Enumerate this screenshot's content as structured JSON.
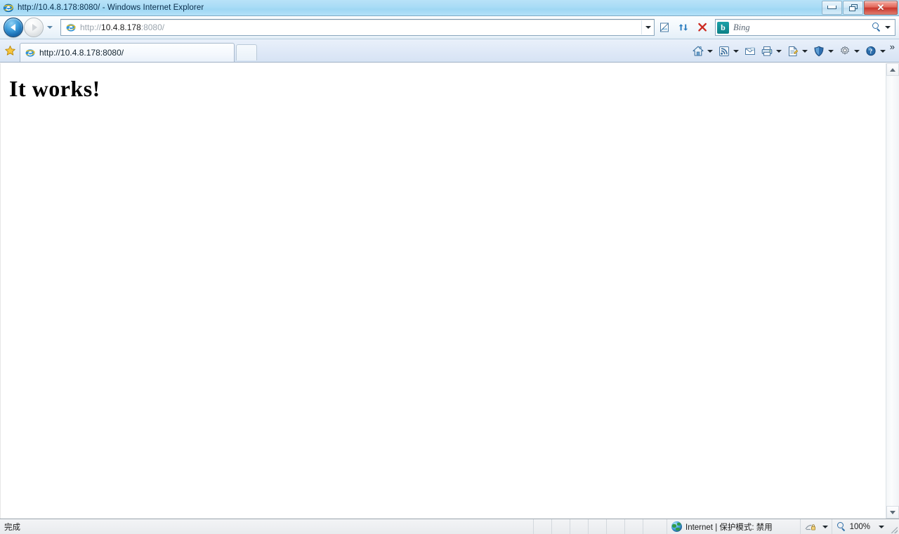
{
  "window": {
    "title": "http://10.4.8.178:8080/ - Windows Internet Explorer",
    "app_icon": "internet-explorer-icon",
    "controls": {
      "minimize_label": "–",
      "restore_label": "❐",
      "close_label": "✕"
    }
  },
  "navigation": {
    "back_label": "←",
    "forward_label": "→",
    "recent_pages_label": "▾"
  },
  "address_bar": {
    "favicon": "internet-explorer-icon",
    "url_scheme": "http://",
    "url_host": "10.4.8.178",
    "url_rest": ":8080/",
    "url_full": "http://10.4.8.178:8080/",
    "dropdown_label": "▾",
    "buttons": [
      {
        "name": "compatibility-view-button",
        "glyph": "▤"
      },
      {
        "name": "refresh-button",
        "glyph": "↻"
      },
      {
        "name": "stop-button",
        "glyph": "✕"
      }
    ]
  },
  "search": {
    "provider": "Bing",
    "placeholder": "Bing",
    "logo_letter": "b",
    "search_icon": "magnifier-icon",
    "dropdown_label": "▾"
  },
  "tabs": {
    "favorites_star": "★",
    "items": [
      {
        "label": "http://10.4.8.178:8080/",
        "favicon": "internet-explorer-icon",
        "active": true
      }
    ],
    "new_tab_label": ""
  },
  "command_bar": {
    "items": [
      {
        "name": "home-button",
        "icon": "home-icon",
        "has_caret": true
      },
      {
        "name": "feeds-button",
        "icon": "rss-feed-icon",
        "has_caret": true
      },
      {
        "name": "mail-button",
        "icon": "mail-icon",
        "has_caret": false
      },
      {
        "name": "print-button",
        "icon": "printer-icon",
        "has_caret": true
      },
      {
        "name": "page-button",
        "icon": "page-icon",
        "has_caret": true
      },
      {
        "name": "safety-button",
        "icon": "shield-icon",
        "has_caret": true
      },
      {
        "name": "tools-button",
        "icon": "gear-icon",
        "has_caret": true
      },
      {
        "name": "help-button",
        "icon": "help-icon",
        "has_caret": true
      }
    ],
    "overflow_label": "»"
  },
  "page": {
    "heading": "It works!"
  },
  "scrollbar": {
    "up_label": "▲",
    "down_label": "▼"
  },
  "status_bar": {
    "status_text": "完成",
    "zone_icon": "globe-icon",
    "zone_text": "Internet | 保护模式: 禁用",
    "privacy_icon": "privacy-lock-icon",
    "privacy_caret": "▾",
    "zoom_icon": "magnifier-icon",
    "zoom_level": "100%",
    "zoom_caret": "▾"
  },
  "colors": {
    "titlebar": "#a9dcf6",
    "tabbar": "#dfe9f7",
    "accent_blue": "#1463a8",
    "close_red": "#c9362c",
    "bing_teal": "#0c8086"
  }
}
